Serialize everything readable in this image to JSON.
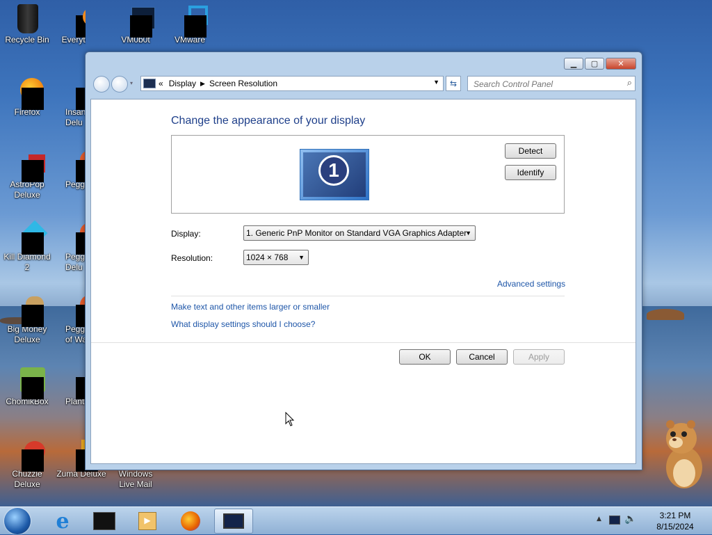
{
  "desktop": {
    "icons": [
      {
        "label": "Recycle Bin"
      },
      {
        "label": "Everything"
      },
      {
        "label": "VM0b0t"
      },
      {
        "label": "VMware"
      },
      {
        "label": "Firefox"
      },
      {
        "label": "Insaniq Delu"
      },
      {
        "label": "AstroPop Deluxe"
      },
      {
        "label": "Peggle I"
      },
      {
        "label": "Kill Diamond 2"
      },
      {
        "label": "Peggle I Delu"
      },
      {
        "label": "Big Money Deluxe"
      },
      {
        "label": "Peggle V of Warc"
      },
      {
        "label": "ChomikBox"
      },
      {
        "label": "Plant Zoml"
      },
      {
        "label": "Chuzzle Deluxe"
      },
      {
        "label": "Zuma Deluxe"
      },
      {
        "label": "Windows Live Mail"
      }
    ]
  },
  "window": {
    "nav": {
      "breadcrumb_prefix": "«",
      "breadcrumb": [
        "Display",
        "Screen Resolution"
      ],
      "search_placeholder": "Search Control Panel"
    },
    "title": "Change the appearance of your display",
    "monitor_number": "1",
    "detect_label": "Detect",
    "identify_label": "Identify",
    "display_label": "Display:",
    "display_value": "1. Generic PnP Monitor on Standard VGA Graphics Adapter",
    "resolution_label": "Resolution:",
    "resolution_value": "1024 × 768",
    "advanced_link": "Advanced settings",
    "links": [
      "Make text and other items larger or smaller",
      "What display settings should I choose?"
    ],
    "ok_label": "OK",
    "cancel_label": "Cancel",
    "apply_label": "Apply",
    "apply_enabled": false
  },
  "taskbar": {
    "clock_time": "3:21 PM",
    "clock_date": "8/15/2024"
  }
}
